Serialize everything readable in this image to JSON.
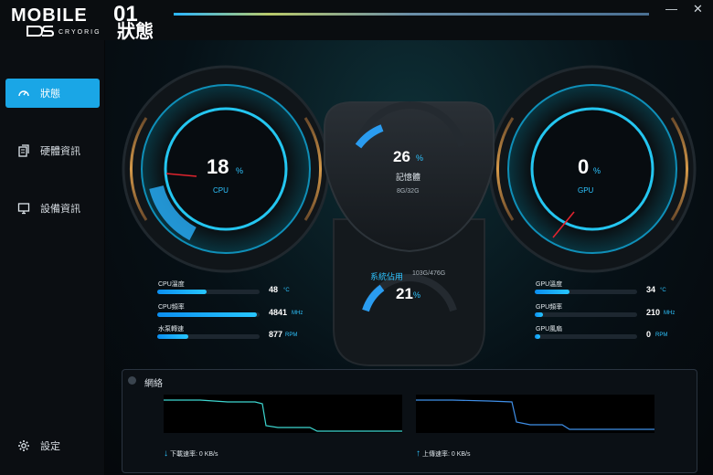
{
  "watermark": {
    "brand": "MOBILE",
    "number": "01",
    "sub": "CRYORIG"
  },
  "window": {
    "minimize": "—",
    "close": "✕"
  },
  "page_title": "狀態",
  "sidebar": {
    "items": [
      {
        "label": "狀態",
        "icon": "gauge-icon",
        "active": true
      },
      {
        "label": "硬體資訊",
        "icon": "documents-icon",
        "active": false
      },
      {
        "label": "設備資訊",
        "icon": "monitor-icon",
        "active": false
      }
    ],
    "settings": {
      "label": "設定",
      "icon": "gear-icon"
    }
  },
  "cpu": {
    "value": "18",
    "unit": "%",
    "label": "CPU",
    "level": 0.18
  },
  "gpu": {
    "value": "0",
    "unit": "%",
    "label": "GPU",
    "level": 0.0
  },
  "memory": {
    "value": "26",
    "unit": "%",
    "label": "記憶體",
    "detail": "8G/32G",
    "level": 0.26
  },
  "system": {
    "label": "系統佔用",
    "detail": "103G/476G",
    "value": "21",
    "unit": "%",
    "level": 0.21
  },
  "cpu_stats": [
    {
      "label": "CPU溫度",
      "value": "48",
      "unit": "°C",
      "level": 0.48
    },
    {
      "label": "CPU頻率",
      "value": "4841",
      "unit": "MHz",
      "level": 0.97
    },
    {
      "label": "水泵轉速",
      "value": "877",
      "unit": "RPM",
      "level": 0.3
    }
  ],
  "gpu_stats": [
    {
      "label": "GPU溫度",
      "value": "34",
      "unit": "°C",
      "level": 0.34
    },
    {
      "label": "GPU頻率",
      "value": "210",
      "unit": "MHz",
      "level": 0.08
    },
    {
      "label": "GPU風扇",
      "value": "0",
      "unit": "RPM",
      "level": 0.05
    }
  ],
  "network": {
    "title": "網絡",
    "download": {
      "label": "下載速率:",
      "value": "0",
      "unit": "KB/s"
    },
    "upload": {
      "label": "上傳速率:",
      "value": "0",
      "unit": "KB/s"
    }
  },
  "colors": {
    "accent": "#1aa6e6",
    "cyan": "#2ec4ff",
    "download_line": "#3dd6d0",
    "upload_line": "#3f8fe8",
    "needle": "#e0242e"
  }
}
